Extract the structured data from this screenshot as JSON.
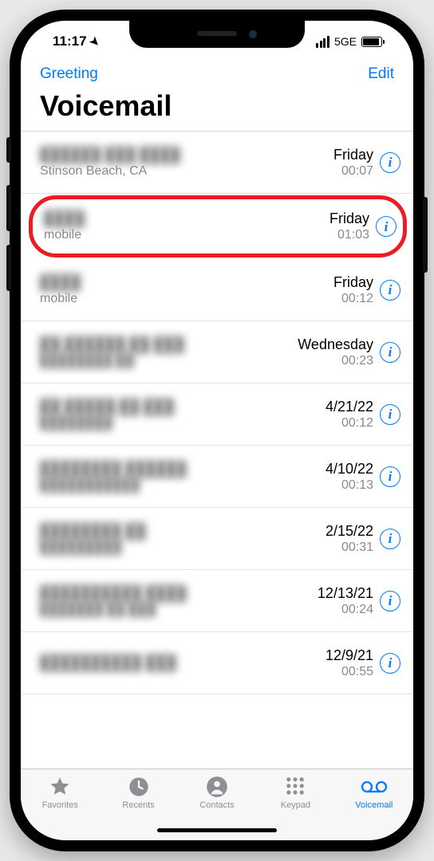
{
  "status_bar": {
    "time": "11:17",
    "network_label": "5GE"
  },
  "nav": {
    "greeting_label": "Greeting",
    "edit_label": "Edit"
  },
  "title": "Voicemail",
  "voicemails": [
    {
      "caller": "██████ ███ ████",
      "subtitle": "Stinson Beach, CA",
      "date": "Friday",
      "duration": "00:07",
      "caller_blurred": true,
      "subtitle_blurred": false,
      "highlighted": false
    },
    {
      "caller": "████",
      "subtitle": "mobile",
      "date": "Friday",
      "duration": "01:03",
      "caller_blurred": true,
      "subtitle_blurred": false,
      "highlighted": true
    },
    {
      "caller": "████",
      "subtitle": "mobile",
      "date": "Friday",
      "duration": "00:12",
      "caller_blurred": true,
      "subtitle_blurred": false,
      "highlighted": false
    },
    {
      "caller": "██ ██████ ██ ███",
      "subtitle": "████████ ██",
      "date": "Wednesday",
      "duration": "00:23",
      "caller_blurred": true,
      "subtitle_blurred": true,
      "highlighted": false
    },
    {
      "caller": "██ █████ ██ ███",
      "subtitle": "████████",
      "date": "4/21/22",
      "duration": "00:12",
      "caller_blurred": true,
      "subtitle_blurred": true,
      "highlighted": false
    },
    {
      "caller": "████████ ██████",
      "subtitle": "███████████",
      "date": "4/10/22",
      "duration": "00:13",
      "caller_blurred": true,
      "subtitle_blurred": true,
      "highlighted": false
    },
    {
      "caller": "████████ ██",
      "subtitle": "█████████",
      "date": "2/15/22",
      "duration": "00:31",
      "caller_blurred": true,
      "subtitle_blurred": true,
      "highlighted": false
    },
    {
      "caller": "██████████ ████",
      "subtitle": "███████ ██ ███",
      "date": "12/13/21",
      "duration": "00:24",
      "caller_blurred": true,
      "subtitle_blurred": true,
      "highlighted": false
    },
    {
      "caller": "██████████ ███",
      "subtitle": "",
      "date": "12/9/21",
      "duration": "00:55",
      "caller_blurred": true,
      "subtitle_blurred": true,
      "highlighted": false
    }
  ],
  "tabs": {
    "favorites": "Favorites",
    "recents": "Recents",
    "contacts": "Contacts",
    "keypad": "Keypad",
    "voicemail": "Voicemail"
  }
}
